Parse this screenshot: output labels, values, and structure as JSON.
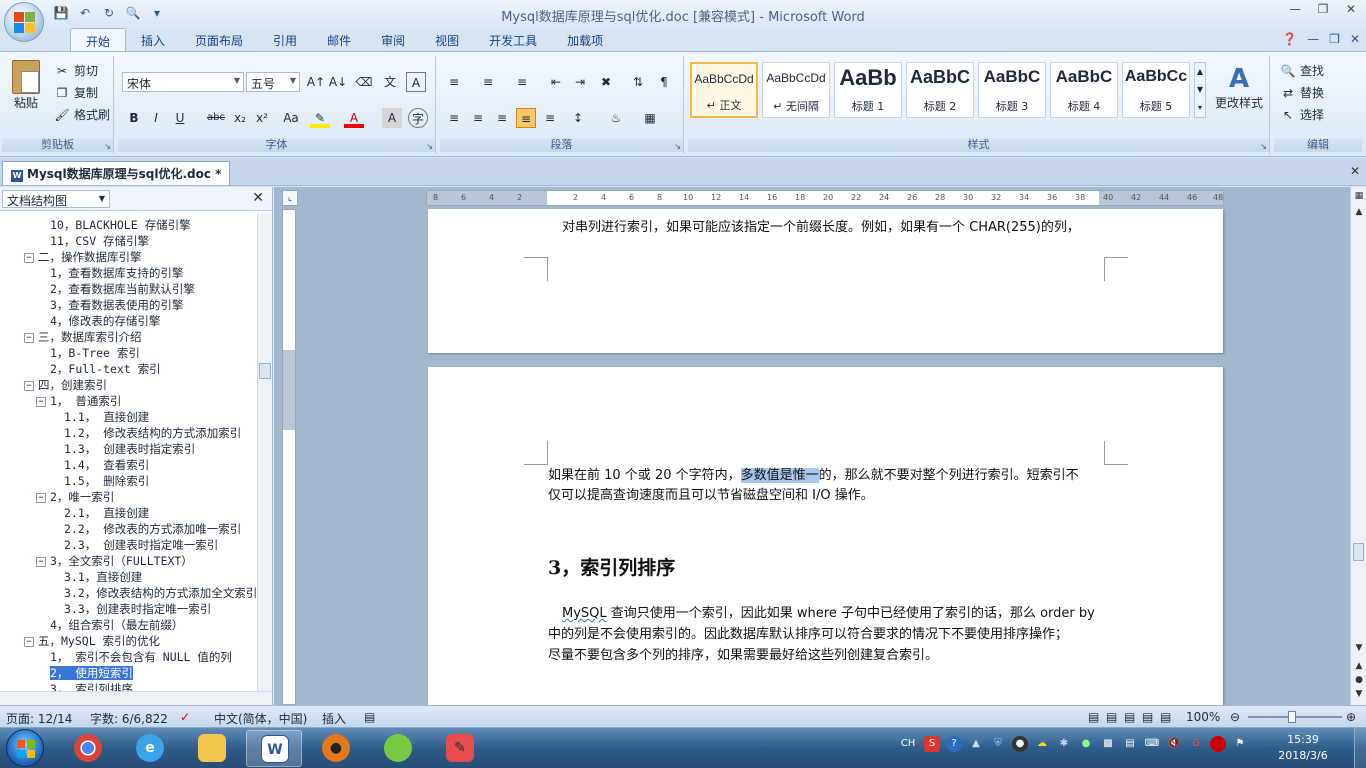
{
  "window": {
    "title": "Mysql数据库原理与sql优化.doc [兼容模式] - Microsoft Word"
  },
  "tabs": [
    "开始",
    "插入",
    "页面布局",
    "引用",
    "邮件",
    "审阅",
    "视图",
    "开发工具",
    "加载项"
  ],
  "ribbon": {
    "clipboard": {
      "label": "剪贴板",
      "paste": "粘贴",
      "cut": "剪切",
      "copy": "复制",
      "format_painter": "格式刷"
    },
    "font": {
      "label": "字体",
      "font_name": "宋体",
      "font_size": "五号"
    },
    "paragraph": {
      "label": "段落"
    },
    "styles": {
      "label": "样式",
      "items": [
        {
          "sample": "AaBbCcDd",
          "name": "↵ 正文"
        },
        {
          "sample": "AaBbCcDd",
          "name": "↵ 无间隔"
        },
        {
          "sample": "AaBb",
          "name": "标题 1"
        },
        {
          "sample": "AaBbC",
          "name": "标题 2"
        },
        {
          "sample": "AaBbC",
          "name": "标题 3"
        },
        {
          "sample": "AaBbC",
          "name": "标题 4"
        },
        {
          "sample": "AaBbCc",
          "name": "标题 5"
        }
      ],
      "change_styles": "更改样式"
    },
    "editing": {
      "label": "编辑",
      "find": "查找",
      "replace": "替换",
      "select": "选择"
    }
  },
  "doc_tab": {
    "title": "Mysql数据库原理与sql优化.doc *"
  },
  "nav": {
    "dropdown": "文档结构图",
    "items": [
      {
        "text": "10，BLACKHOLE 存储引擎"
      },
      {
        "text": "11，CSV 存储引擎"
      },
      {
        "text": "二，操作数据库引擎",
        "toggle": "−"
      },
      {
        "text": "1，查看数据库支持的引擎"
      },
      {
        "text": "2，查看数据库当前默认引擎"
      },
      {
        "text": "3，查看数据表使用的引擎"
      },
      {
        "text": "4，修改表的存储引擎"
      },
      {
        "text": "三，数据库索引介绍",
        "toggle": "−"
      },
      {
        "text": "1，B-Tree 索引"
      },
      {
        "text": "2，Full-text 索引"
      },
      {
        "text": "四，创建索引",
        "toggle": "−"
      },
      {
        "text": "1， 普通索引",
        "toggle": "−"
      },
      {
        "text": "1.1， 直接创建"
      },
      {
        "text": "1.2， 修改表结构的方式添加索引"
      },
      {
        "text": "1.3， 创建表时指定索引"
      },
      {
        "text": "1.4， 查看索引"
      },
      {
        "text": "1.5， 删除索引"
      },
      {
        "text": "2，唯一索引",
        "toggle": "−"
      },
      {
        "text": "2.1， 直接创建"
      },
      {
        "text": "2.2， 修改表的方式添加唯一索引"
      },
      {
        "text": "2.3， 创建表时指定唯一索引"
      },
      {
        "text": "3，全文索引（FULLTEXT）",
        "toggle": "−"
      },
      {
        "text": "3.1，直接创建"
      },
      {
        "text": "3.2，修改表结构的方式添加全文索引"
      },
      {
        "text": "3.3，创建表时指定唯一索引"
      },
      {
        "text": "4，组合索引（最左前缀）"
      },
      {
        "text": "五，MySQL 索引的优化",
        "toggle": "−"
      },
      {
        "text": "1， 索引不会包含有 NULL 值的列"
      },
      {
        "text": "2， 使用短索引"
      },
      {
        "text": "3， 索引列排序"
      }
    ]
  },
  "ruler": {
    "numbers": [
      "8",
      "6",
      "4",
      "2",
      "",
      "2",
      "4",
      "6",
      "8",
      "10",
      "12",
      "14",
      "16",
      "18",
      "20",
      "22",
      "24",
      "26",
      "28",
      "30",
      "32",
      "34",
      "36",
      "38",
      "40",
      "42",
      "44",
      "46",
      "48"
    ]
  },
  "document": {
    "page1_line": "对串列进行索引，如果可能应该指定一个前缀长度。例如，如果有一个 CHAR(255)的列，",
    "p2_a": "如果在前 10 个或 20 个字符内，",
    "p2_sel": "多数值是惟一",
    "p2_b": "的，那么就不要对整个列进行索引。短索引不",
    "p2_line2": "仅可以提高查询速度而且可以节省磁盘空间和 I/O 操作。",
    "heading": "3，索引列排序",
    "p3_mysql": "MySQL",
    "p3_line1_rest": " 查询只使用一个索引，因此如果 where 子句中已经使用了索引的话，那么 order by",
    "p3_line2": "中的列是不会使用索引的。因此数据库默认排序可以符合要求的情况下不要使用排序操作；",
    "p3_line3": "尽量不要包含多个列的排序，如果需要最好给这些列创建复合索引。"
  },
  "status": {
    "page": "页面: 12/14",
    "words": "字数: 6/6,822",
    "language": "中文(简体，中国)",
    "insert": "插入",
    "zoom": "100%"
  },
  "taskbar": {
    "lang": "CH",
    "time": "15:39",
    "date": "2018/3/6"
  },
  "colors": {
    "accent": "#2b5797",
    "selection": "#3875d7",
    "ribbon_bg": "#dbe8f6"
  }
}
